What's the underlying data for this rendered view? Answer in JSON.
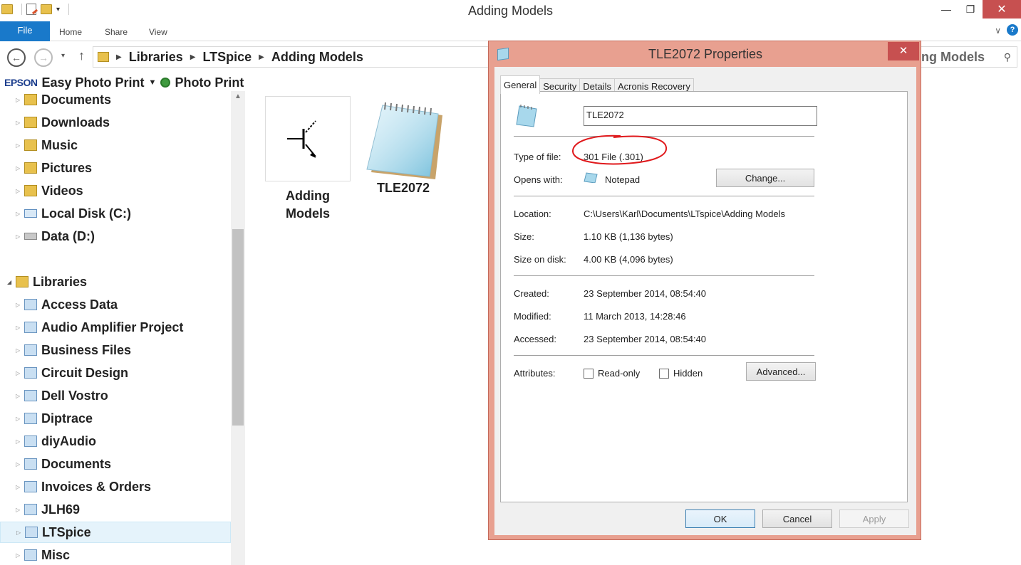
{
  "window": {
    "title": "Adding Models"
  },
  "ribbon": {
    "tabs": [
      "File",
      "Home",
      "Share",
      "View"
    ]
  },
  "address": {
    "path": [
      "Libraries",
      "LTSpice",
      "Adding Models"
    ],
    "search_partial": "ng Models"
  },
  "epson_toolbar": {
    "brand": "EPSON",
    "easy_photo_print": "Easy Photo Print",
    "photo_print": "Photo Print"
  },
  "nav": {
    "items": [
      {
        "label": "Documents",
        "icon": "folder-icon"
      },
      {
        "label": "Downloads",
        "icon": "folder-icon"
      },
      {
        "label": "Music",
        "icon": "folder-icon"
      },
      {
        "label": "Pictures",
        "icon": "folder-icon"
      },
      {
        "label": "Videos",
        "icon": "folder-icon"
      },
      {
        "label": "Local Disk (C:)",
        "icon": "system-disk-icon"
      },
      {
        "label": "Data (D:)",
        "icon": "disk-icon"
      },
      {
        "label": "Libraries",
        "icon": "libraries-icon"
      },
      {
        "label": "Access Data",
        "icon": "library-icon"
      },
      {
        "label": "Audio Amplifier Project",
        "icon": "library-icon"
      },
      {
        "label": "Business Files",
        "icon": "library-icon"
      },
      {
        "label": "Circuit Design",
        "icon": "library-icon"
      },
      {
        "label": "Dell Vostro",
        "icon": "library-icon"
      },
      {
        "label": "Diptrace",
        "icon": "library-icon"
      },
      {
        "label": "diyAudio",
        "icon": "library-icon"
      },
      {
        "label": "Documents",
        "icon": "library-icon"
      },
      {
        "label": "Invoices & Orders",
        "icon": "library-icon"
      },
      {
        "label": "JLH69",
        "icon": "library-icon"
      },
      {
        "label": "LTSpice",
        "icon": "library-icon"
      },
      {
        "label": "Misc",
        "icon": "library-icon"
      }
    ]
  },
  "files": [
    {
      "name": "Adding Models",
      "icon": "transistor-symbol-icon"
    },
    {
      "name": "TLE2072",
      "icon": "notepad-icon"
    }
  ],
  "dialog": {
    "title": "TLE2072 Properties",
    "tabs": [
      "General",
      "Security",
      "Details",
      "Acronis Recovery"
    ],
    "file_name": "TLE2072",
    "type_label": "Type of file:",
    "type_value": "301 File (.301)",
    "opens_label": "Opens with:",
    "opens_value": "Notepad",
    "change_button": "Change...",
    "location_label": "Location:",
    "location_value": "C:\\Users\\Karl\\Documents\\LTspice\\Adding Models",
    "size_label": "Size:",
    "size_value": "1.10 KB (1,136 bytes)",
    "size_disk_label": "Size on disk:",
    "size_disk_value": "4.00 KB (4,096 bytes)",
    "created_label": "Created:",
    "created_value": "23 September 2014, 08:54:40",
    "modified_label": "Modified:",
    "modified_value": "11 March 2013, 14:28:46",
    "accessed_label": "Accessed:",
    "accessed_value": "23 September 2014, 08:54:40",
    "attributes_label": "Attributes:",
    "readonly_label": "Read-only",
    "hidden_label": "Hidden",
    "advanced_button": "Advanced...",
    "ok_button": "OK",
    "cancel_button": "Cancel",
    "apply_button": "Apply",
    "annotation_color": "#e0191c"
  }
}
